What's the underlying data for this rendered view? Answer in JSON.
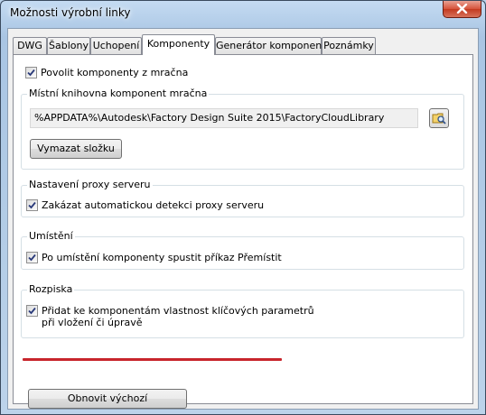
{
  "window": {
    "title": "Možnosti výrobní linky"
  },
  "tabs": [
    {
      "label": "DWG"
    },
    {
      "label": "Šablony"
    },
    {
      "label": "Uchopení"
    },
    {
      "label": "Komponenty"
    },
    {
      "label": "Generátor komponent"
    },
    {
      "label": "Poznámky"
    }
  ],
  "active_tab": "Komponenty",
  "components": {
    "cloud_checkbox": {
      "label": "Povolit komponenty z mračna",
      "checked": true
    },
    "local_library": {
      "title": "Místní knihovna komponent mračna",
      "path_value": "%APPDATA%\\Autodesk\\Factory Design Suite 2015\\FactoryCloudLibrary",
      "browse_icon": "folder-browse-icon",
      "clear_button": "Vymazat složku"
    },
    "proxy": {
      "title": "Nastavení proxy serveru",
      "checkbox": {
        "label": "Zakázat automatickou detekci proxy serveru",
        "checked": true
      }
    },
    "placement": {
      "title": "Umístění",
      "checkbox": {
        "label": "Po umístění komponenty spustit příkaz Přemístit",
        "checked": true
      }
    },
    "bom": {
      "title": "Rozpiska",
      "checkbox": {
        "label_line1": "Přidat ke komponentám vlastnost klíčových parametrů",
        "label_line2": "při vložení či úpravě",
        "checked": true
      },
      "highlight_color": "#c8252c"
    },
    "reset_button": "Obnovit výchozí"
  },
  "colors": {
    "titlebar": "#a9c5e3",
    "close": "#c33a20",
    "panel": "#ffffff"
  }
}
